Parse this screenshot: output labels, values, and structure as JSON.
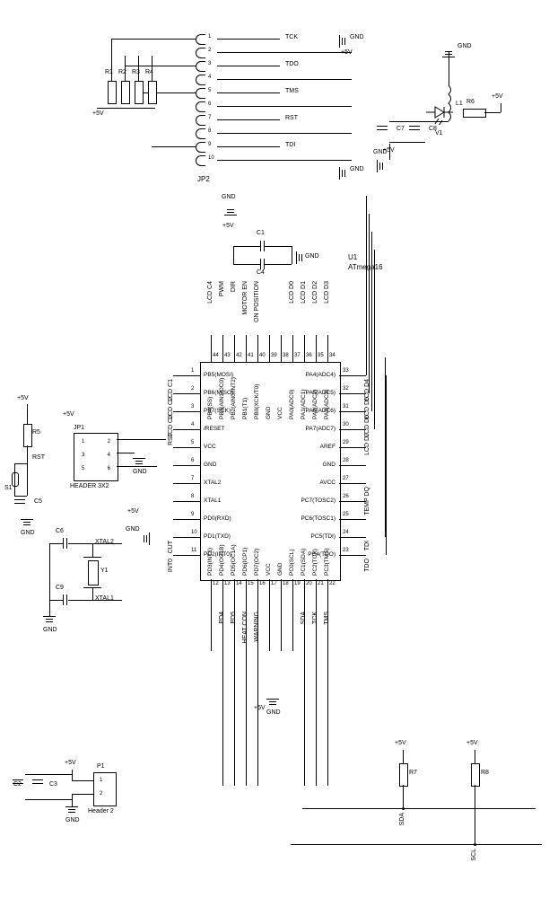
{
  "chip": {
    "refdes": "U1",
    "part": "ATmega16",
    "pins_left": [
      {
        "num": "1",
        "name": "PB5(MOSI)"
      },
      {
        "num": "2",
        "name": "PB6(MISO)"
      },
      {
        "num": "3",
        "name": "PB7(SCK)"
      },
      {
        "num": "4",
        "name": "/RESET"
      },
      {
        "num": "5",
        "name": "VCC"
      },
      {
        "num": "6",
        "name": "GND"
      },
      {
        "num": "7",
        "name": "XTAL2"
      },
      {
        "num": "8",
        "name": "XTAL1"
      },
      {
        "num": "9",
        "name": "PD0(RXD)"
      },
      {
        "num": "10",
        "name": "PD1(TXD)"
      },
      {
        "num": "11",
        "name": "PD2(INT0)"
      }
    ],
    "pins_bottom": [
      {
        "num": "12",
        "name": "PD3(INT1)"
      },
      {
        "num": "13",
        "name": "PD4(OC1B)"
      },
      {
        "num": "14",
        "name": "PD5(OC1A)"
      },
      {
        "num": "15",
        "name": "PD6(ICP1)"
      },
      {
        "num": "16",
        "name": "PD7(OC2)"
      },
      {
        "num": "17",
        "name": "VCC"
      },
      {
        "num": "18",
        "name": "GND"
      },
      {
        "num": "19",
        "name": "PC0(SCL)"
      },
      {
        "num": "20",
        "name": "PC1(SDA)"
      },
      {
        "num": "21",
        "name": "PC2(TCK)"
      },
      {
        "num": "22",
        "name": "PC3(TMS)"
      }
    ],
    "pins_right": [
      {
        "num": "33",
        "name": "PA4(ADC4)"
      },
      {
        "num": "32",
        "name": "PA5(ADC5)"
      },
      {
        "num": "31",
        "name": "PA6(ADC6)"
      },
      {
        "num": "30",
        "name": "PA7(ADC7)"
      },
      {
        "num": "29",
        "name": "AREF"
      },
      {
        "num": "28",
        "name": "GND"
      },
      {
        "num": "27",
        "name": "AVCC"
      },
      {
        "num": "26",
        "name": "PC7(TOSC2)"
      },
      {
        "num": "25",
        "name": "PC6(TOSC1)"
      },
      {
        "num": "24",
        "name": "PC5(TDI)"
      },
      {
        "num": "23",
        "name": "PC4(TDO)"
      }
    ],
    "pins_top": [
      {
        "num": "44",
        "name": "PB4(SS)"
      },
      {
        "num": "43",
        "name": "PB3(AIN1/OC0)"
      },
      {
        "num": "42",
        "name": "PB2(AIN0/INT2)"
      },
      {
        "num": "41",
        "name": "PB1(T1)"
      },
      {
        "num": "40",
        "name": "PB0(XCK/T0)"
      },
      {
        "num": "39",
        "name": "GND"
      },
      {
        "num": "38",
        "name": "VCC"
      },
      {
        "num": "37",
        "name": "PA0(ADC0)"
      },
      {
        "num": "36",
        "name": "PA1(ADC1)"
      },
      {
        "num": "35",
        "name": "PA2(ADC2)"
      },
      {
        "num": "34",
        "name": "PA3(ADC3)"
      }
    ]
  },
  "nets_top": [
    "LCD C4",
    "PWM",
    "DIR",
    "MOTOR EN",
    "ON POSITION",
    "",
    "",
    "LCD D0",
    "LCD D1",
    "LCD D2",
    "LCD D3"
  ],
  "nets_left": [
    "LCD C1",
    "LCD C2",
    "LCD C3",
    "RST",
    "",
    "",
    "",
    "",
    "",
    "CUT",
    "INT0"
  ],
  "nets_right": [
    "LCD D4",
    "LCD D5",
    "LCD D6",
    "LCD D7",
    "",
    "",
    "TEMP DQ",
    "",
    "",
    "TDI",
    "TDO"
  ],
  "nets_bottom": [
    "",
    "PD4",
    "PD5",
    "HEAT CON",
    "WARNING",
    "",
    "",
    "",
    "SDA",
    "TCK",
    "TMS"
  ],
  "headers": {
    "jp1": {
      "ref": "JP1",
      "type": "HEADER 3X2",
      "pins": [
        "1",
        "2",
        "3",
        "4",
        "5",
        "6"
      ]
    },
    "jp2": {
      "ref": "JP2",
      "pins_right": [
        "1",
        "2",
        "3",
        "4",
        "5",
        "6",
        "7",
        "8",
        "9",
        "10"
      ],
      "labels": [
        "TCK",
        "",
        "TDO",
        "",
        "TMS",
        "",
        "RST",
        "",
        "TDI",
        ""
      ]
    },
    "p1": {
      "ref": "P1",
      "type": "Header 2",
      "pins": [
        "1",
        "2"
      ]
    }
  },
  "discretes": {
    "r1": "R1",
    "r2": "R2",
    "r3": "R3",
    "r4": "R4",
    "r5": "R5",
    "r6": "R6",
    "r7": "R7",
    "r8": "R8",
    "c1": "C1",
    "c2": "C2",
    "c3": "C3",
    "c4": "C4",
    "c5": "C5",
    "c6": "C6",
    "c7": "C7",
    "c8": "C8",
    "c9": "C9",
    "l1": "L1",
    "v1": "V1",
    "y1": "Y1",
    "s1": "S1"
  },
  "power": {
    "p5v": "+5V",
    "gnd": "GND"
  },
  "signals": {
    "xtal1": "XTAL1",
    "xtal2": "XTAL2",
    "rst": "RST",
    "sda": "SDA",
    "scl": "SCL"
  }
}
